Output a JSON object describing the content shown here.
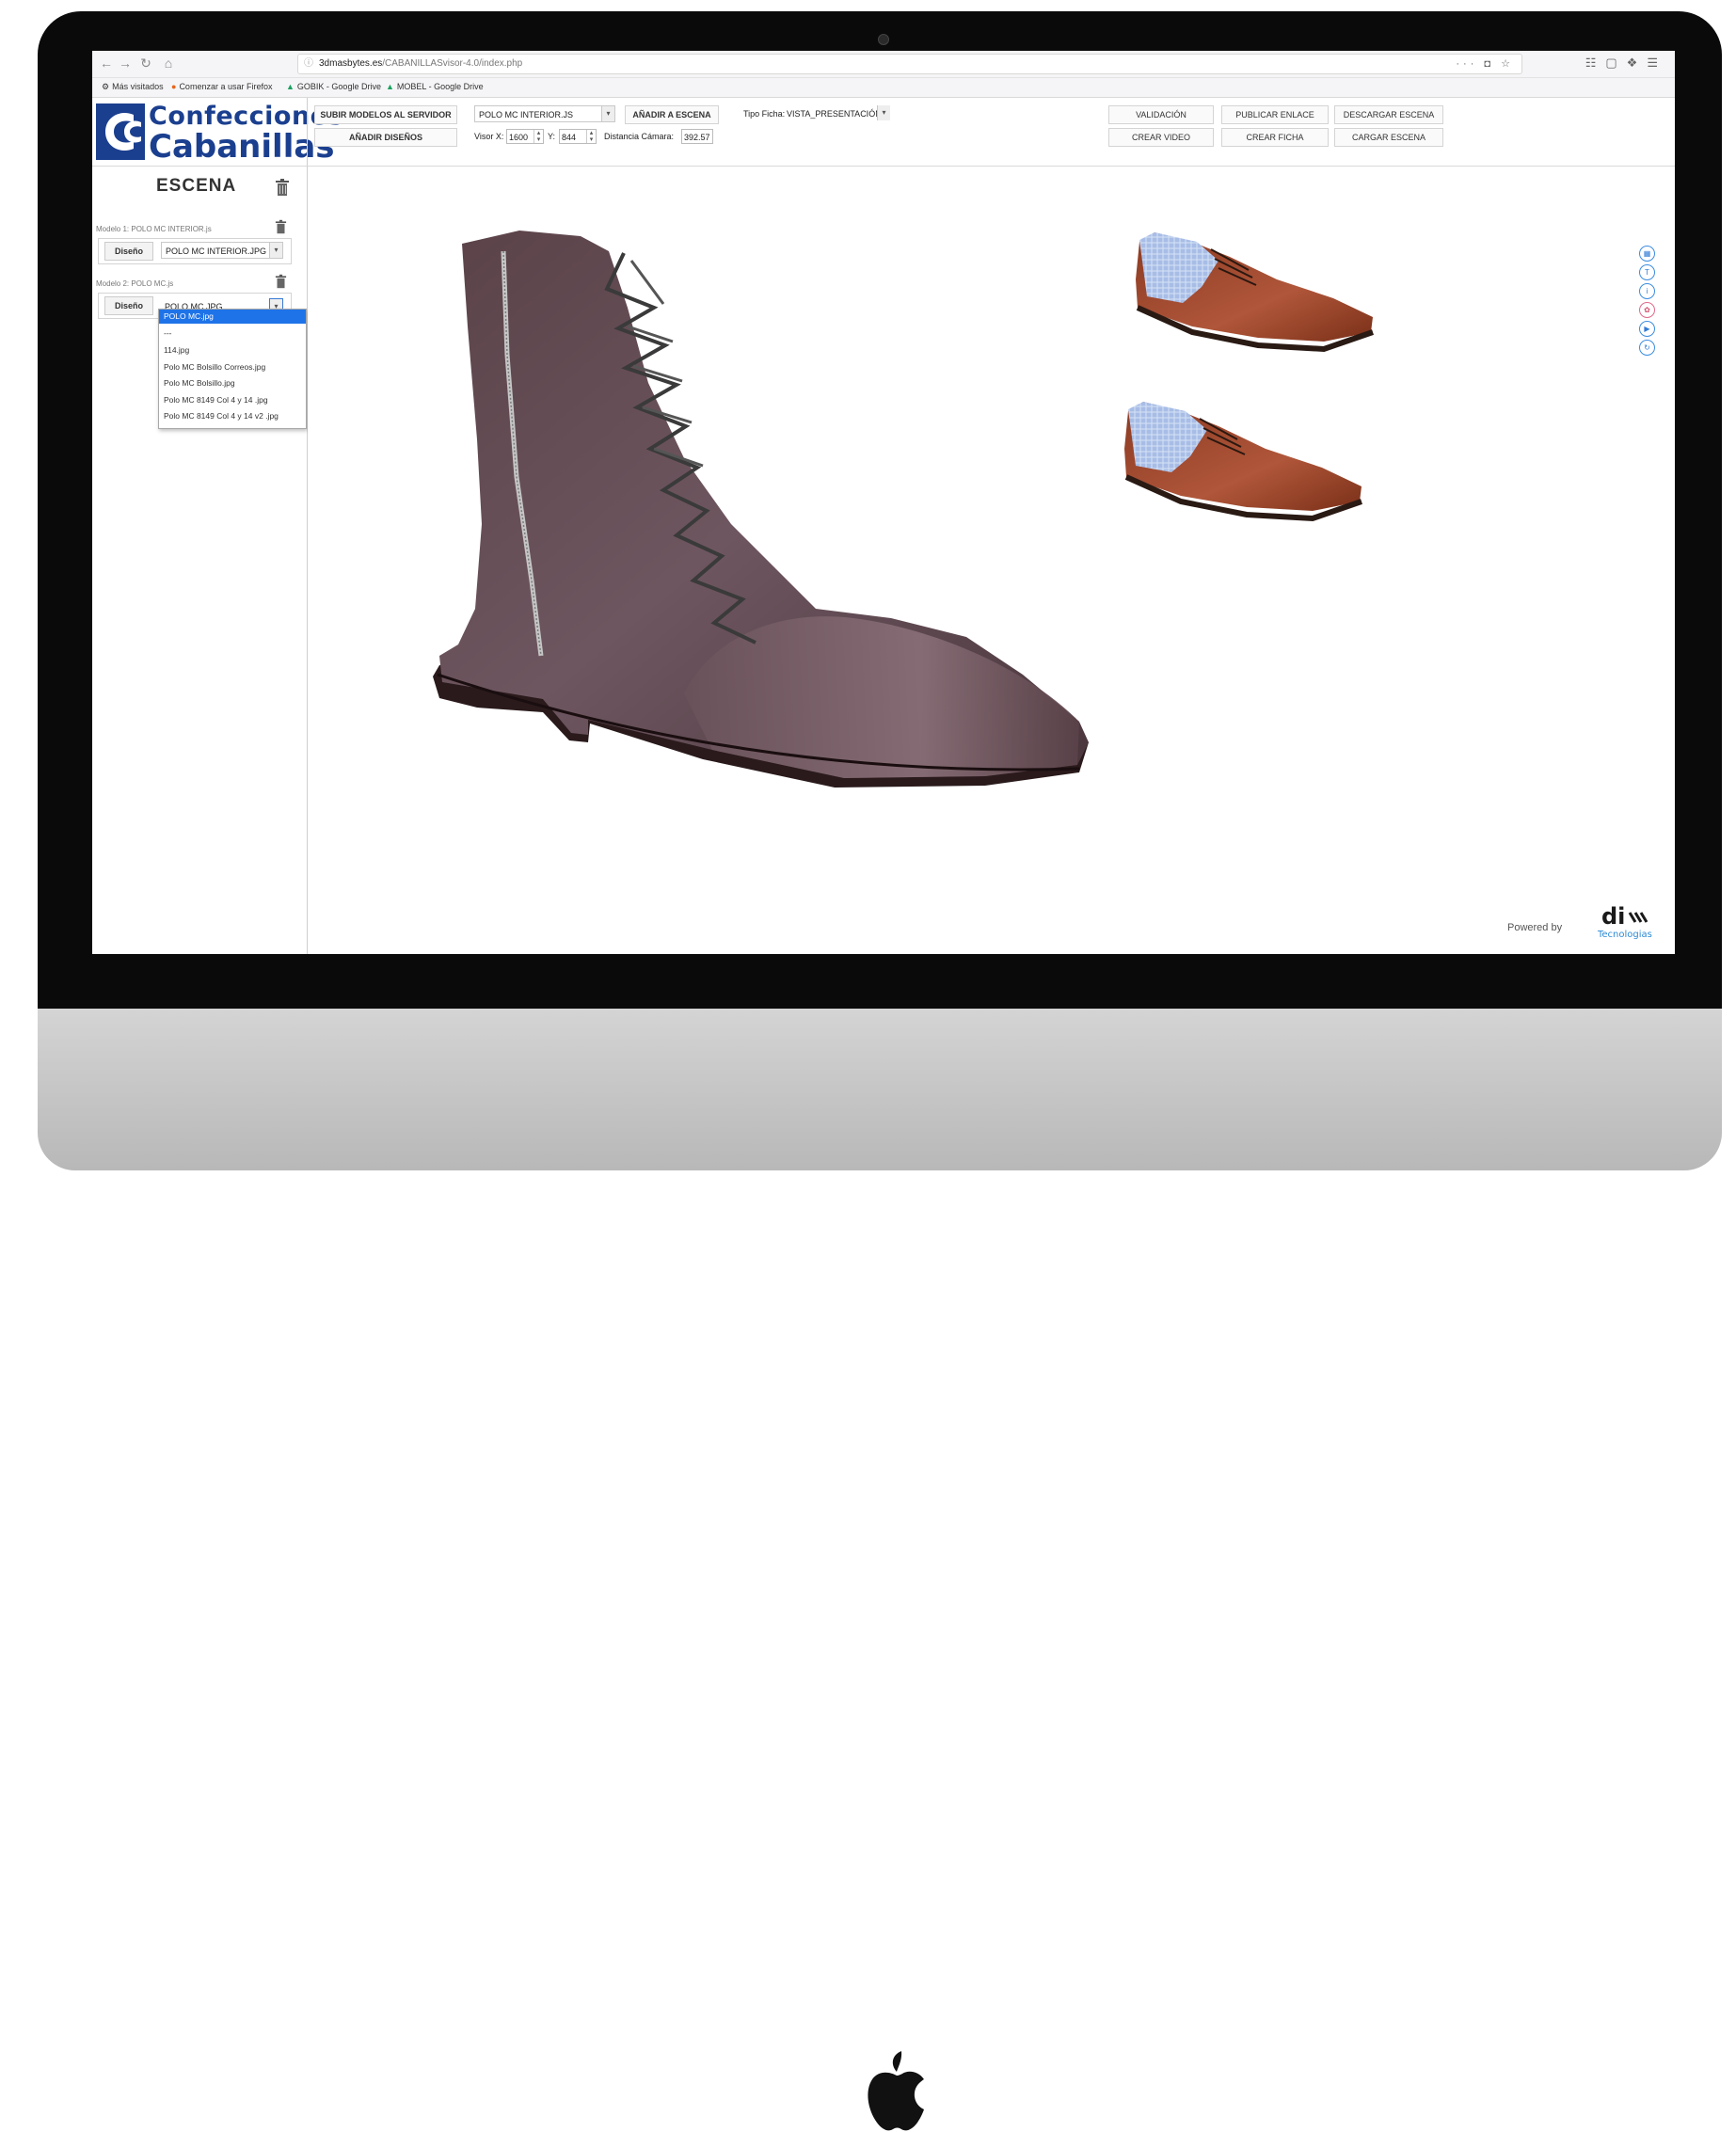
{
  "browser": {
    "url_host": "3dmasbytes.es",
    "url_path": "/CABANILLASvisor-4.0/index.php",
    "url_actions": "··· ◘ ☆",
    "bookmarks": [
      "Más visitados",
      "Comenzar a usar Firefox",
      "GOBIK - Google Drive",
      "MOBEL - Google Drive"
    ]
  },
  "brand": {
    "line1": "Confecciones",
    "line2": "Cabanillas",
    "color": "#1b3f8f"
  },
  "toolbar": {
    "upload_models": "SUBIR MODELOS AL SERVIDOR",
    "add_designs": "AÑADIR DISEÑOS",
    "model_select": "POLO MC INTERIOR.JS",
    "add_to_scene": "AÑADIR A ESCENA",
    "sheet_type_label": "Tipo Ficha:",
    "sheet_type_value": "VISTA_PRESENTACIÓN",
    "visor_x_label": "Visor X:",
    "visor_x": "1600",
    "y_label": "Y:",
    "visor_y": "844",
    "camera_distance_label": "Distancia Cámara:",
    "camera_distance": "392.57",
    "validation": "VALIDACIÓN",
    "publish_link": "PUBLICAR ENLACE",
    "download_scene": "DESCARGAR ESCENA",
    "create_video": "CREAR VIDEO",
    "create_sheet": "CREAR FICHA",
    "load_scene": "CARGAR ESCENA"
  },
  "sidebar": {
    "title": "ESCENA",
    "models": [
      {
        "label": "Modelo 1: POLO MC INTERIOR.js",
        "design_button": "Diseño",
        "design_value": "POLO MC INTERIOR.JPG"
      },
      {
        "label": "Modelo 2: POLO MC.js",
        "design_button": "Diseño",
        "design_value": "POLO MC.JPG"
      }
    ],
    "dropdown_options": [
      "POLO MC.jpg",
      "---",
      "114.jpg",
      "Polo MC Bolsillo Correos.jpg",
      "Polo MC Bolsillo.jpg",
      "Polo MC 8149 Col 4 y 14 .jpg",
      "Polo MC 8149 Col 4 y 14 v2 .jpg"
    ]
  },
  "viewer": {
    "side_icons": [
      "grid-icon",
      "text-icon",
      "info-icon",
      "palette-icon",
      "play-icon",
      "reset-icon"
    ],
    "powered_by": "Powered by",
    "partner_logo": "di Tecnologias"
  }
}
